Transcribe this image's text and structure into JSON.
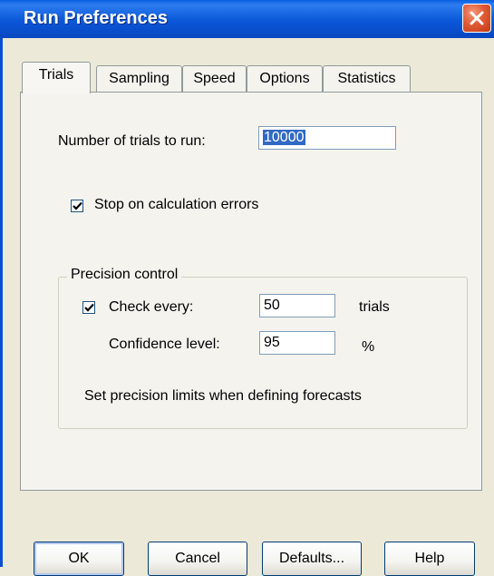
{
  "window": {
    "title": "Run Preferences",
    "accent_color": "#0A57D8",
    "close_color": "#E05A36"
  },
  "tabs": [
    {
      "label": "Trials",
      "active": true
    },
    {
      "label": "Sampling",
      "active": false
    },
    {
      "label": "Speed",
      "active": false
    },
    {
      "label": "Options",
      "active": false
    },
    {
      "label": "Statistics",
      "active": false
    }
  ],
  "trials": {
    "num_trials_label": "Number of trials to run:",
    "num_trials_value": "10000",
    "stop_on_errors_label": "Stop on calculation errors",
    "stop_on_errors_checked": true
  },
  "precision": {
    "group_title": "Precision control",
    "check_every_label": "Check every:",
    "check_every_checked": true,
    "check_every_value": "50",
    "check_every_unit": "trials",
    "confidence_label": "Confidence level:",
    "confidence_value": "95",
    "confidence_unit": "%",
    "note": "Set precision limits when defining forecasts"
  },
  "buttons": {
    "ok": "OK",
    "cancel": "Cancel",
    "defaults": "Defaults...",
    "help": "Help"
  }
}
